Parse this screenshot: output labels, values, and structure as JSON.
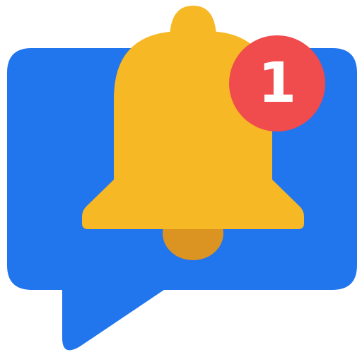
{
  "icon": {
    "name": "notification-bell-chat-icon",
    "parts": [
      "chat-bubble-icon",
      "bell-icon",
      "notification-badge"
    ]
  },
  "colors": {
    "bubble": "#2175ED",
    "bell": "#F6B824",
    "clapper": "#DB9322",
    "badge": "#F04B4D",
    "badge_text": "#FFFFFF"
  },
  "badge": {
    "count": "1"
  }
}
